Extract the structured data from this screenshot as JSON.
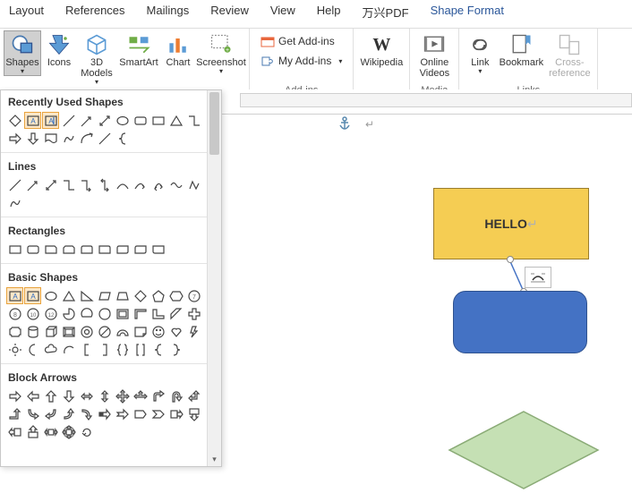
{
  "tabs": {
    "items": [
      "Layout",
      "References",
      "Mailings",
      "Review",
      "View",
      "Help",
      "万兴PDF",
      "Shape Format"
    ]
  },
  "ribbon": {
    "shapes": "Shapes",
    "icons": "Icons",
    "models": "3D Models",
    "smartart": "SmartArt",
    "chart": "Chart",
    "screenshot": "Screenshot",
    "get_addins": "Get Add-ins",
    "my_addins": "My Add-ins",
    "wikipedia": "Wikipedia",
    "online_videos": "Online Videos",
    "link": "Link",
    "bookmark": "Bookmark",
    "crossref": "Cross-reference",
    "group_addins": "Add-ins",
    "group_media": "Media",
    "group_links": "Links"
  },
  "dropdown": {
    "recently_used": "Recently Used Shapes",
    "lines": "Lines",
    "rectangles": "Rectangles",
    "basic_shapes": "Basic Shapes",
    "block_arrows": "Block Arrows"
  },
  "canvas": {
    "hello": "HELLO"
  }
}
